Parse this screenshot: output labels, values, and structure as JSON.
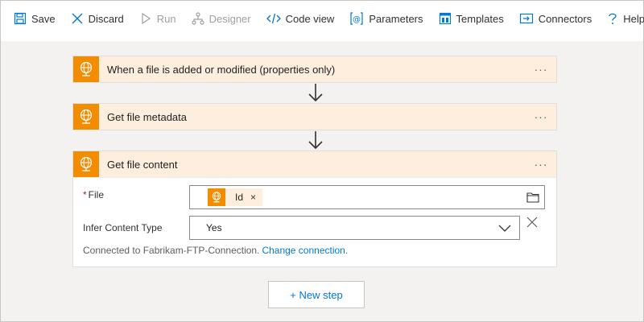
{
  "toolbar": {
    "save": "Save",
    "discard": "Discard",
    "run": "Run",
    "designer": "Designer",
    "code_view": "Code view",
    "parameters": "Parameters",
    "templates": "Templates",
    "connectors": "Connectors",
    "help": "Help"
  },
  "cards": [
    {
      "title": "When a file is added or modified (properties only)",
      "more": "···"
    },
    {
      "title": "Get file metadata",
      "more": "···"
    },
    {
      "title": "Get file content",
      "more": "···"
    }
  ],
  "get_file_content": {
    "file_label": "File",
    "required_mark": "*",
    "file_token": "Id",
    "file_token_remove": "×",
    "infer_label": "Infer Content Type",
    "infer_value": "Yes",
    "connected_text": "Connected to Fabrikam-FTP-Connection.",
    "change_connection": "Change connection."
  },
  "new_step": "+ New step",
  "colors": {
    "connector_orange": "#f28c00",
    "card_header": "#fdeedd",
    "link_blue": "#0078d4",
    "highlight_red": "#e00000"
  }
}
